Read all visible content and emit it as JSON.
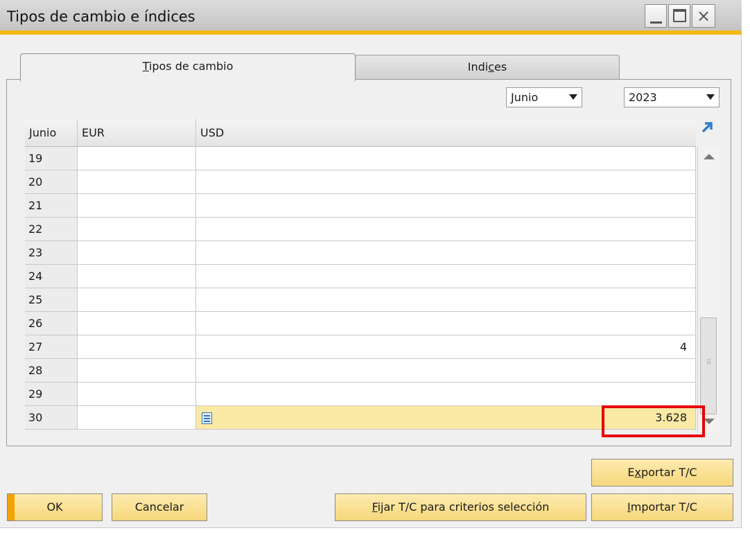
{
  "window": {
    "title": "Tipos de cambio e índices",
    "controls": {
      "minimize": "minimize-icon",
      "maximize": "maximize-icon",
      "close": "×"
    }
  },
  "tabs": [
    {
      "label_u": "T",
      "label_rest": "ipos de cambio",
      "active": true
    },
    {
      "label_pre": "Indi",
      "label_u": "c",
      "label_rest": "es",
      "active": false
    }
  ],
  "filters": {
    "month": "Junio",
    "year": "2023"
  },
  "grid": {
    "columns": [
      "Junio",
      "EUR",
      "USD"
    ],
    "rows": [
      {
        "day": "19",
        "eur": "",
        "usd": ""
      },
      {
        "day": "20",
        "eur": "",
        "usd": ""
      },
      {
        "day": "21",
        "eur": "",
        "usd": ""
      },
      {
        "day": "22",
        "eur": "",
        "usd": ""
      },
      {
        "day": "23",
        "eur": "",
        "usd": ""
      },
      {
        "day": "24",
        "eur": "",
        "usd": ""
      },
      {
        "day": "25",
        "eur": "",
        "usd": ""
      },
      {
        "day": "26",
        "eur": "",
        "usd": ""
      },
      {
        "day": "27",
        "eur": "",
        "usd": "4"
      },
      {
        "day": "28",
        "eur": "",
        "usd": ""
      },
      {
        "day": "29",
        "eur": "",
        "usd": ""
      },
      {
        "day": "30",
        "eur": "",
        "usd": "3.628"
      }
    ],
    "selected_row": "30"
  },
  "buttons": {
    "ok": "OK",
    "cancel": "Cancelar",
    "fijar_u": "F",
    "fijar_rest": "ijar T/C para criterios selección",
    "importar_u": "I",
    "importar_rest": "mportar T/C",
    "exportar_pre": "E",
    "exportar_u": "x",
    "exportar_rest": "portar T/C"
  },
  "colors": {
    "accent": "#f5b800",
    "button": "#f6d77a",
    "selected_row": "#fbe9a6",
    "highlight_box": "#e60000"
  }
}
